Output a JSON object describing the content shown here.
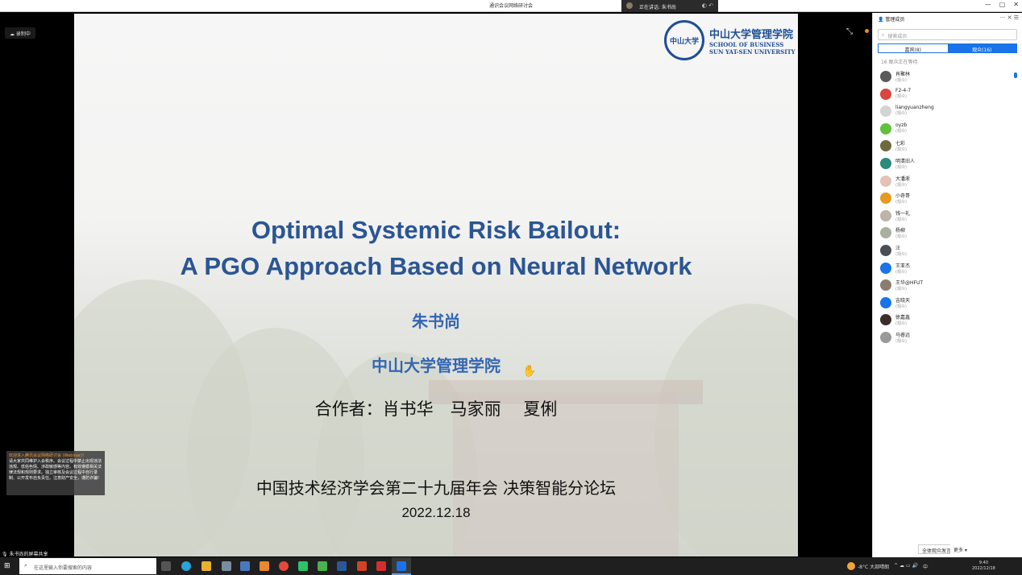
{
  "window": {
    "title": "通识会议网络研讨会",
    "speaking_label": "正在讲话: 朱书尚",
    "controls": [
      "—",
      "▢",
      "✕"
    ]
  },
  "stage": {
    "rec_label": "录制中",
    "speaker_bar": "朱书尚的屏幕共享",
    "notice": {
      "title": "欢迎进入腾讯会议网络研讨会 (Webinar)!",
      "body": "请大家共同维护入会秩序。会议过程中禁止出现违法违规、低俗色情、涉政敏感等内容。有效遵循相关法律法规和规则要求。独立审核及会议过程中自行录制、公开发布自负责任。注意财产安全，谨防诈骗!"
    }
  },
  "slide": {
    "logo_seal": "中山大学",
    "logo_cn": "中山大学管理学院",
    "logo_en_1": "SCHOOL OF BUSINESS",
    "logo_en_2": "SUN YAT-SEN UNIVERSITY",
    "title_line1": "Optimal Systemic Risk Bailout:",
    "title_line2": "A PGO Approach Based on Neural Network",
    "author": "朱书尚",
    "school": "中山大学管理学院",
    "coauthors": "合作者：肖书华　马家丽　 夏俐",
    "conference": "中国技术经济学会第二十九届年会 决策智能分论坛",
    "date": "2022.12.18"
  },
  "panel": {
    "title": "管理成员",
    "search_placeholder": "搜索成员",
    "tabs": [
      "嘉宾(8)",
      "观众(16)"
    ],
    "active_tab": 1,
    "section_label": "16 观众正在等待",
    "members": [
      {
        "name": "肖聚林",
        "status": "(观众)",
        "color": "#5b5b5b",
        "mic": true
      },
      {
        "name": "F2-4-7",
        "status": "(观众)",
        "color": "#d9463b",
        "mic": false
      },
      {
        "name": "liangyuanzheng",
        "status": "(观众)",
        "color": "#d4d4d4",
        "mic": false
      },
      {
        "name": "oyzb",
        "status": "(观众)",
        "color": "#5fc13d",
        "mic": false
      },
      {
        "name": "七彩",
        "status": "(观众)",
        "color": "#6d6a3c",
        "mic": false
      },
      {
        "name": "明清旧人",
        "status": "(观众)",
        "color": "#2c8a7a",
        "mic": false
      },
      {
        "name": "大潘淅",
        "status": "(观众)",
        "color": "#e3c2b5",
        "mic": false
      },
      {
        "name": "小奇哥",
        "status": "(观众)",
        "color": "#e59b1f",
        "mic": false
      },
      {
        "name": "钱一礼",
        "status": "(观众)",
        "color": "#bdb3a8",
        "mic": false
      },
      {
        "name": "杨柳",
        "status": "(观众)",
        "color": "#a9b0a0",
        "mic": false
      },
      {
        "name": "汪",
        "status": "(观众)",
        "color": "#4a4f55",
        "mic": false
      },
      {
        "name": "王亚杰",
        "status": "(观众)",
        "color": "#1a73e8",
        "mic": false
      },
      {
        "name": "王华@HFUT",
        "status": "(观众)",
        "color": "#8a7d70",
        "mic": false
      },
      {
        "name": "吉晓天",
        "status": "(观众)",
        "color": "#1a73e8",
        "mic": false
      },
      {
        "name": "徐嘉鑫",
        "status": "(观众)",
        "color": "#3a2e2a",
        "mic": false
      },
      {
        "name": "马睿远",
        "status": "(观众)",
        "color": "#9a9a9a",
        "mic": false
      }
    ],
    "footer_btn1": "全体观众发言",
    "footer_btn2": "更多 ▾"
  },
  "taskbar": {
    "search_placeholder": "在这里输入你要搜索的内容",
    "weather": "-8°C 大部晴朗",
    "lang": "中",
    "time": "9:40",
    "date": "2022/12/18"
  }
}
